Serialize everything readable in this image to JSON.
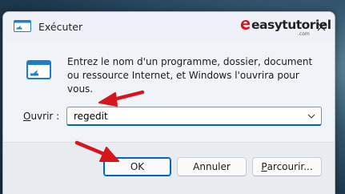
{
  "window": {
    "title": "Exécuter",
    "close_symbol": "✕"
  },
  "watermark": {
    "text": "easytutoriel",
    "sub": ".com"
  },
  "dialog": {
    "description": "Entrez le nom d'un programme, dossier, document ou ressource Internet, et Windows l'ouvrira pour vous.",
    "open_label_underlined": "O",
    "open_label_rest": "uvrir :",
    "input_value": "regedit"
  },
  "buttons": {
    "ok": "OK",
    "cancel": "Annuler",
    "browse_underlined": "P",
    "browse_rest": "arcourir..."
  },
  "colors": {
    "accent": "#0067c0",
    "annotation_arrow": "#d6161c"
  },
  "icons": {
    "app": "run-dialog-icon",
    "close": "close-icon",
    "dropdown": "chevron-down-icon",
    "run": "run-program-icon"
  }
}
